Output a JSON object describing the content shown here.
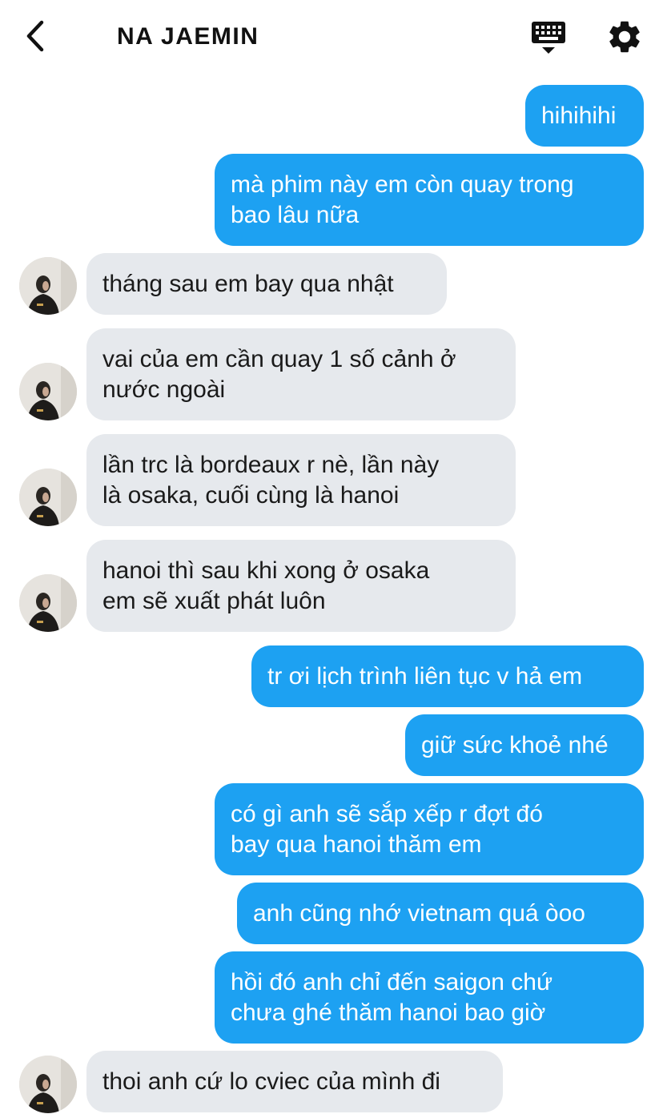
{
  "header": {
    "title": "NA JAEMIN",
    "back_icon": "chevron-left-icon",
    "keyboard_icon": "keyboard-icon",
    "settings_icon": "gear-icon"
  },
  "colors": {
    "sent_bubble": "#1da1f2",
    "received_bubble": "#e6e9ed",
    "sent_text": "#ffffff",
    "received_text": "#1a1a1a"
  },
  "messages": [
    {
      "side": "sent",
      "text": "hihihihi"
    },
    {
      "side": "sent",
      "text": "mà phim này em còn quay trong\nbao lâu nữa"
    },
    {
      "side": "received",
      "text": "tháng sau em bay qua nhật"
    },
    {
      "side": "received",
      "text": "vai của em cần quay 1 số cảnh ở\nnước ngoài"
    },
    {
      "side": "received",
      "text": "lần trc là bordeaux r nè, lần này\nlà osaka, cuối cùng là hanoi"
    },
    {
      "side": "received",
      "text": "hanoi thì sau khi xong ở osaka\nem sẽ xuất phát luôn"
    },
    {
      "side": "sent",
      "text": "tr ơi lịch trình liên tục v hả em"
    },
    {
      "side": "sent",
      "text": "giữ sức khoẻ nhé"
    },
    {
      "side": "sent",
      "text": "có gì anh sẽ sắp xếp r đợt đó\nbay qua hanoi thăm em"
    },
    {
      "side": "sent",
      "text": "anh cũng nhớ vietnam quá òoo"
    },
    {
      "side": "sent",
      "text": "hồi đó anh chỉ đến saigon chứ\nchưa ghé thăm hanoi bao giờ"
    },
    {
      "side": "received",
      "text": "thoi anh cứ lo cviec của mình đi"
    }
  ]
}
